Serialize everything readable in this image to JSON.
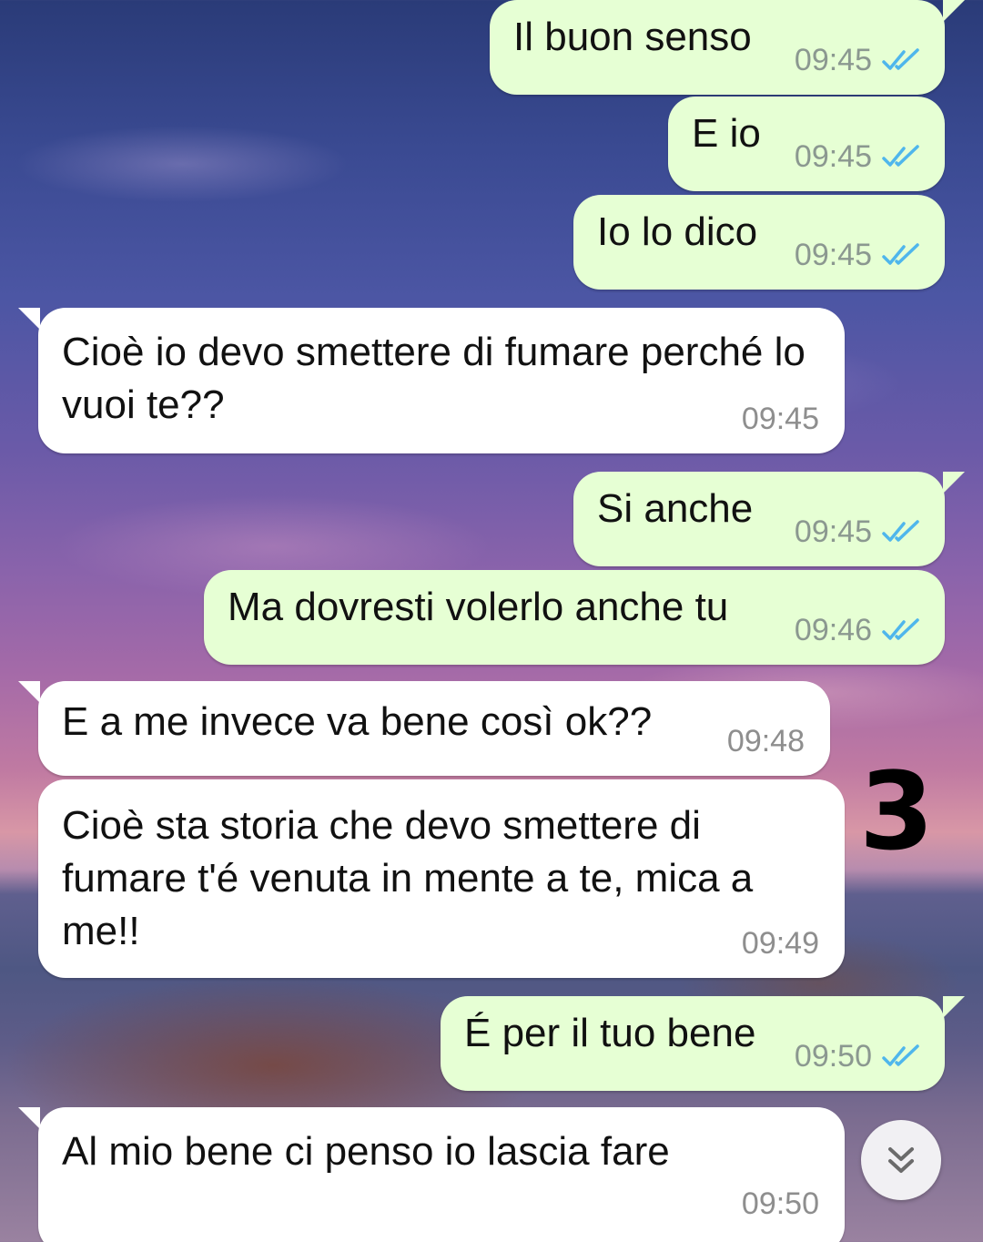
{
  "messages": [
    {
      "dir": "out",
      "text": "Il buon senso",
      "time": "09:45",
      "status": "read"
    },
    {
      "dir": "out",
      "text": "E io",
      "time": "09:45",
      "status": "read"
    },
    {
      "dir": "out",
      "text": "Io lo dico",
      "time": "09:45",
      "status": "read"
    },
    {
      "dir": "in",
      "text": "Cioè io devo smettere di fumare perché lo vuoi te??",
      "time": "09:45"
    },
    {
      "dir": "out",
      "text": "Si anche",
      "time": "09:45",
      "status": "read"
    },
    {
      "dir": "out",
      "text": "Ma dovresti volerlo anche tu",
      "time": "09:46",
      "status": "read"
    },
    {
      "dir": "in",
      "text": "E a me invece va bene così ok??",
      "time": "09:48"
    },
    {
      "dir": "in",
      "text": "Cioè sta storia che devo smettere di fumare t'é venuta in mente a te, mica a me!!",
      "time": "09:49"
    },
    {
      "dir": "out",
      "text": "É per il tuo bene",
      "time": "09:50",
      "status": "read"
    },
    {
      "dir": "in",
      "text": "Al mio bene ci penso io lascia fare",
      "time": "09:50"
    }
  ],
  "annotation": "3",
  "icons": {
    "read_receipt": "double-check-icon",
    "scroll_down": "chevron-double-down-icon"
  },
  "colors": {
    "outgoing_bubble": "#e6ffd4",
    "incoming_bubble": "#ffffff",
    "read_tick": "#4fb6ec",
    "timestamp": "#8b9890"
  }
}
